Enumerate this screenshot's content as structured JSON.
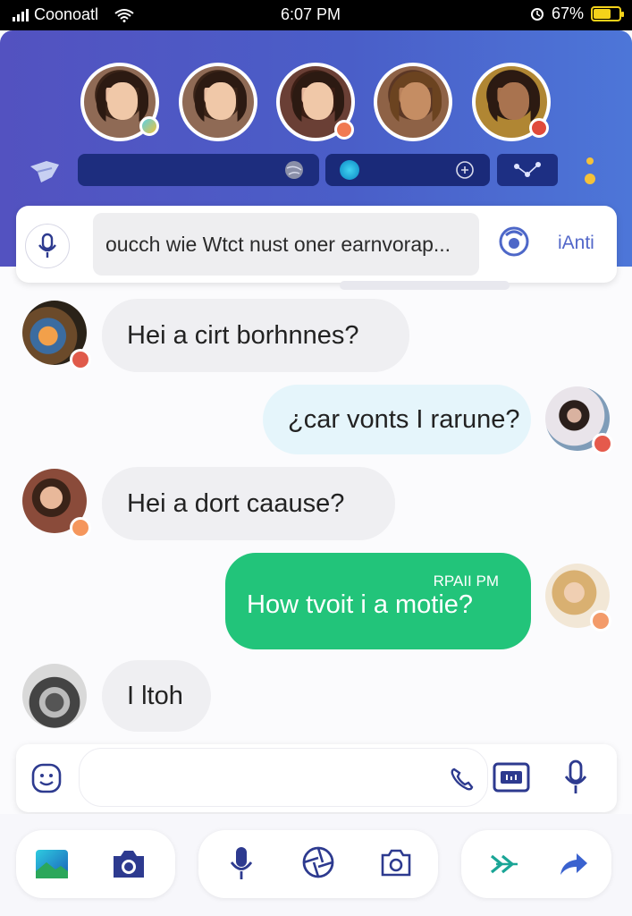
{
  "status_bar": {
    "carrier": "Coonoatl",
    "time": "6:07 PM",
    "battery": "67%",
    "battery_level": 0.67
  },
  "header": {
    "stories": [
      {
        "name": "story-avatar-1"
      },
      {
        "name": "story-avatar-2"
      },
      {
        "name": "story-avatar-3"
      },
      {
        "name": "story-avatar-4"
      },
      {
        "name": "story-avatar-5"
      }
    ]
  },
  "top_input": {
    "prompt_text": "oucch wie Wtct nust oner earnvorap...",
    "ai_label": "iAnti"
  },
  "messages": [
    {
      "direction": "incoming",
      "text": "Hei a cirt borhnnes?"
    },
    {
      "direction": "outgoing",
      "text": "¿car vonts I rarune?"
    },
    {
      "direction": "incoming",
      "text": "Hei a dort caause?"
    },
    {
      "direction": "outgoing",
      "text": "How tvoit i a motie?",
      "timestamp": "RPAII PM"
    },
    {
      "direction": "incoming",
      "text": "I ltoh"
    }
  ],
  "composer": {
    "placeholder": ""
  },
  "colors": {
    "header_start": "#5352c0",
    "header_end": "#4d76d8",
    "outgoing_green": "#22c47a",
    "outgoing_light": "#e5f5fb",
    "incoming": "#efeff2",
    "accent": "#3a3f9f"
  },
  "icons": {
    "status": [
      "signal-icon",
      "wifi-icon",
      "alarm-icon",
      "battery-icon"
    ],
    "header": [
      "bird-icon",
      "globe-icon",
      "dot-icon",
      "plugin-icon",
      "dots-icon"
    ],
    "composer": [
      "emoji-icon",
      "phone-icon",
      "video-card-icon",
      "mic-icon"
    ],
    "bottom": [
      "gallery-icon",
      "camera-icon",
      "mic-icon",
      "aperture-icon",
      "camera-outline-icon",
      "double-chevron-icon",
      "forward-icon"
    ]
  }
}
